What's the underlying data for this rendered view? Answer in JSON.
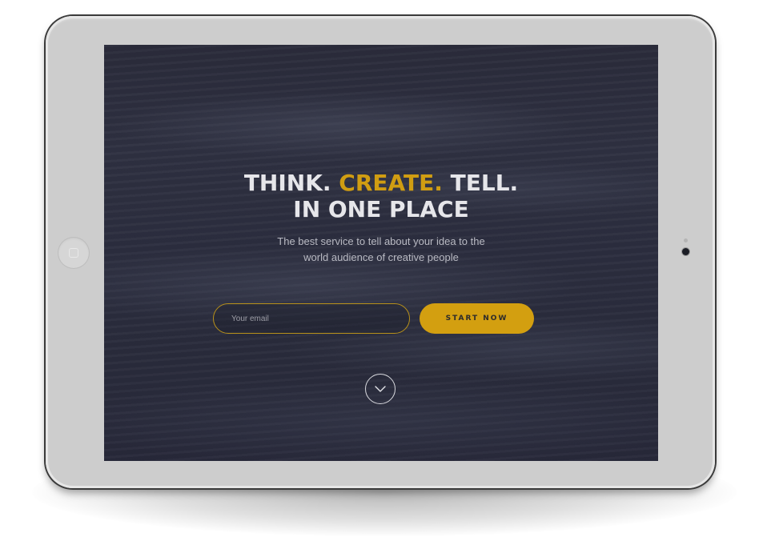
{
  "hero": {
    "title_line1_part1": "THINK.",
    "title_line1_accent": "CREATE.",
    "title_line1_part3": "TELL.",
    "title_line2": "IN ONE PLACE",
    "subtitle_line1": "The best service to tell about your idea to the",
    "subtitle_line2": "world audience of creative people"
  },
  "signup": {
    "email_placeholder": "Your email",
    "email_value": "",
    "button_label": "START NOW"
  },
  "icons": {
    "scroll": "chevron-down-icon",
    "home": "home-button-icon",
    "camera": "camera-icon"
  },
  "colors": {
    "accent": "#d39f10",
    "screen_background": "#2c2e3f",
    "title_text": "#e6e6ea",
    "device_frame": "#cdcdcd"
  }
}
